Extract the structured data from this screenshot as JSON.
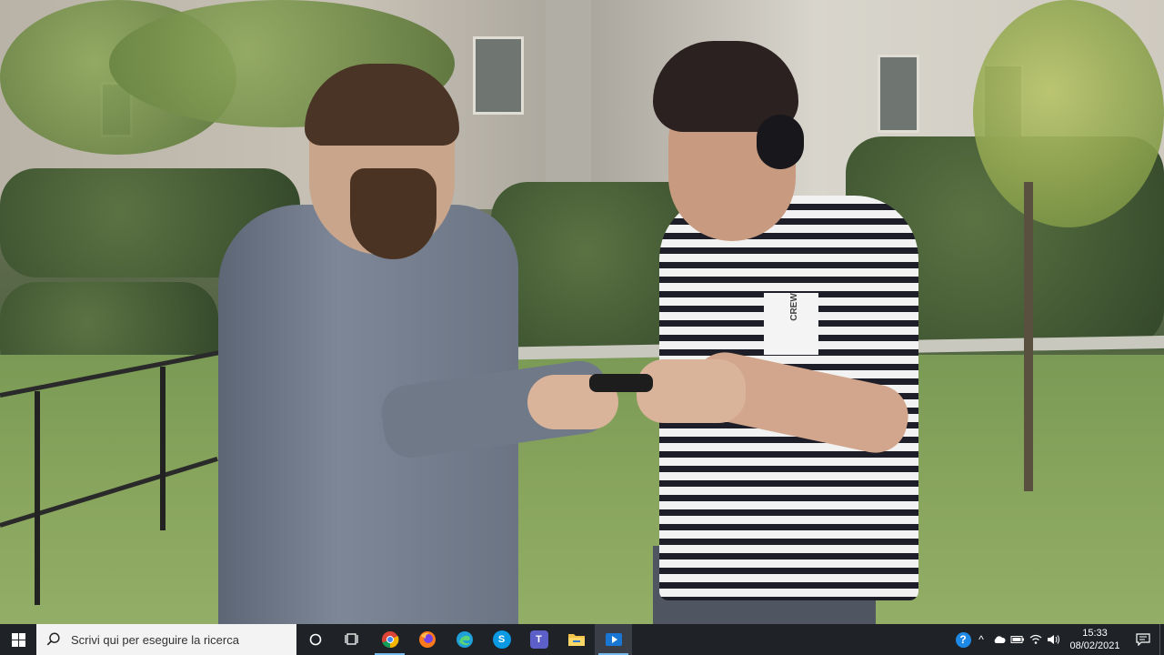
{
  "video": {
    "shirt_brand": "CREW"
  },
  "taskbar": {
    "search_placeholder": "Scrivi qui per eseguire la ricerca",
    "pinned_apps": [
      {
        "icon": "cortana-icon"
      },
      {
        "icon": "task-view-icon"
      },
      {
        "icon": "chrome-icon"
      },
      {
        "icon": "firefox-icon"
      },
      {
        "icon": "edge-icon"
      },
      {
        "icon": "skype-icon",
        "glyph": "S"
      },
      {
        "icon": "teams-icon",
        "glyph": "T"
      },
      {
        "icon": "file-explorer-icon"
      },
      {
        "icon": "video-player-icon"
      }
    ],
    "tray": {
      "help_glyph": "?",
      "chevron_glyph": "^"
    },
    "clock": {
      "time": "15:33",
      "date": "08/02/2021"
    }
  }
}
